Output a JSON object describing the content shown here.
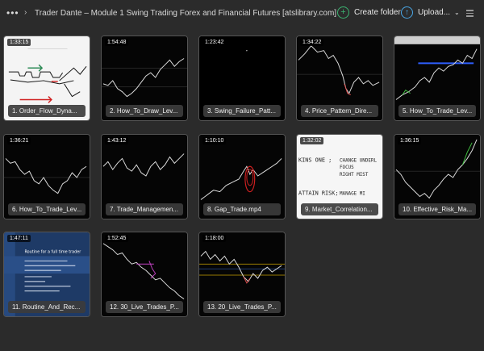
{
  "header": {
    "more_label": "•••",
    "breadcrumb": "Trader Dante – Module 1 Swing Trading Forex and Financial Futures [atslibrary.com]",
    "create_folder_label": "Create folder",
    "upload_label": "Upload...",
    "icons": [
      "more-icon",
      "chevron-right-icon",
      "create-folder-icon",
      "upload-icon",
      "chevron-down-icon",
      "list-view-icon"
    ]
  },
  "files": [
    {
      "duration": "1:33:15",
      "name": "1. Order_Flow_Dyna..."
    },
    {
      "duration": "1:54:48",
      "name": "2. How_To_Draw_Lev..."
    },
    {
      "duration": "1:23:42",
      "name": "3. Swing_Failure_Patt..."
    },
    {
      "duration": "1:34:22",
      "name": "4. Price_Pattern_Dire..."
    },
    {
      "duration": "",
      "name": "5. How_To_Trade_Lev..."
    },
    {
      "duration": "1:36:21",
      "name": "6. How_To_Trade_Lev..."
    },
    {
      "duration": "1:43:12",
      "name": "7. Trade_Managemen..."
    },
    {
      "duration": "1:10:10",
      "name": "8. Gap_Trade.mp4"
    },
    {
      "duration": "1:32:02",
      "name": "9. Market_Correlation..."
    },
    {
      "duration": "1:36:15",
      "name": "10. Effective_Risk_Ma..."
    },
    {
      "duration": "1:47:11",
      "name": "11. Routine_And_Rec..."
    },
    {
      "duration": "1:52:45",
      "name": "12. 30_Live_Trades_P..."
    },
    {
      "duration": "1:18:00",
      "name": "13. 20_Live_Trades_P..."
    }
  ],
  "thumb_text": {
    "whiteboard_lines": [
      "KINS ONE ;",
      "CHANGE UNDERL",
      "FOCUS",
      "RIGHT MIST",
      "ATTAIN RISK;",
      "MANAGE MI"
    ],
    "routine_title": "Routine for a full time trader"
  },
  "colors": {
    "background": "#2b2b2b",
    "create_icon": "#3cb371",
    "upload_icon": "#4aa8e8"
  }
}
